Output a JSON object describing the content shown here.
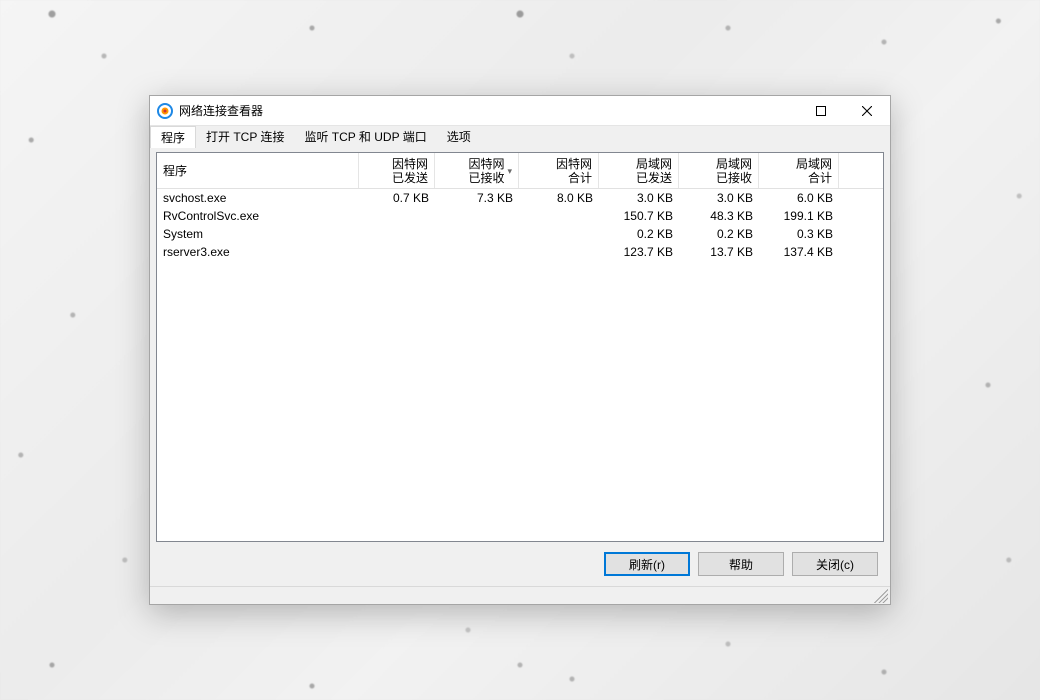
{
  "window": {
    "title": "网络连接查看器",
    "max_icon": "☐",
    "close_icon": "✕"
  },
  "tabs": [
    {
      "label": "程序",
      "active": true
    },
    {
      "label": "打开 TCP 连接",
      "active": false
    },
    {
      "label": "监听 TCP 和 UDP 端口",
      "active": false
    },
    {
      "label": "选项",
      "active": false
    }
  ],
  "columns": [
    {
      "label": "程序"
    },
    {
      "label": "因特网\n已发送"
    },
    {
      "label": "因特网\n已接收",
      "sorted": true
    },
    {
      "label": "因特网\n合计"
    },
    {
      "label": "局域网\n已发送"
    },
    {
      "label": "局域网\n已接收"
    },
    {
      "label": "局域网\n合计"
    }
  ],
  "rows": [
    {
      "cells": [
        "svchost.exe",
        "0.7 KB",
        "7.3 KB",
        "8.0 KB",
        "3.0 KB",
        "3.0 KB",
        "6.0 KB"
      ]
    },
    {
      "cells": [
        "RvControlSvc.exe",
        "",
        "",
        "",
        "150.7 KB",
        "48.3 KB",
        "199.1 KB"
      ]
    },
    {
      "cells": [
        "System",
        "",
        "",
        "",
        "0.2 KB",
        "0.2 KB",
        "0.3 KB"
      ]
    },
    {
      "cells": [
        "rserver3.exe",
        "",
        "",
        "",
        "123.7 KB",
        "13.7 KB",
        "137.4 KB"
      ]
    }
  ],
  "buttons": {
    "refresh": "刷新(r)",
    "help": "帮助",
    "close": "关闭(c)"
  }
}
